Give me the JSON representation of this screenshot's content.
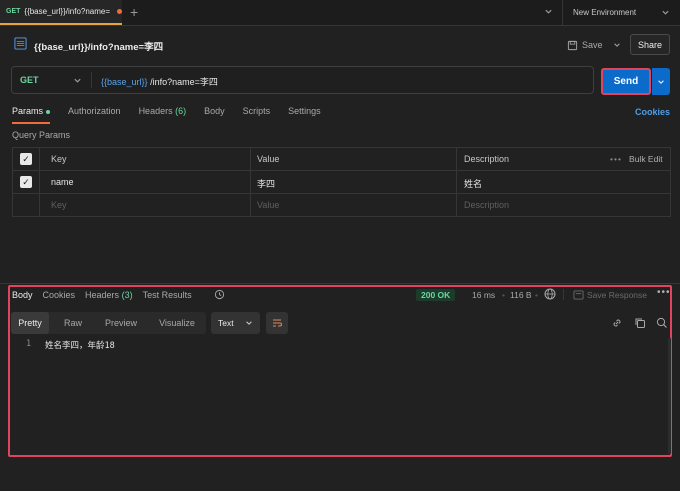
{
  "tab": {
    "method": "GET",
    "title": "{{base_url}}/info?name="
  },
  "environment": {
    "label": "New Environment"
  },
  "request": {
    "title": "{{base_url}}/info?name=李四",
    "save_label": "Save",
    "share_label": "Share",
    "method": "GET",
    "url_var": "{{base_url}}",
    "url_rest": "/info?name=李四",
    "send_label": "Send"
  },
  "request_tabs": [
    {
      "label": "Params"
    },
    {
      "label": "Authorization"
    },
    {
      "label": "Headers",
      "count": "(6)"
    },
    {
      "label": "Body"
    },
    {
      "label": "Scripts"
    },
    {
      "label": "Settings"
    }
  ],
  "cookies_link": "Cookies",
  "query_params": {
    "label": "Query Params",
    "headers": {
      "key": "Key",
      "value": "Value",
      "description": "Description",
      "bulk": "Bulk Edit"
    },
    "rows": [
      {
        "key": "name",
        "value": "李四",
        "description": "姓名"
      }
    ],
    "placeholders": {
      "key": "Key",
      "value": "Value",
      "description": "Description"
    }
  },
  "response": {
    "tabs": [
      {
        "label": "Body"
      },
      {
        "label": "Cookies"
      },
      {
        "label": "Headers",
        "count": "(3)"
      },
      {
        "label": "Test Results"
      }
    ],
    "status": "200 OK",
    "time": "16 ms",
    "size": "116 B",
    "save_response": "Save Response",
    "views": [
      "Pretty",
      "Raw",
      "Preview",
      "Visualize"
    ],
    "format": "Text",
    "line_number": "1",
    "body": "姓名李四，年龄18"
  },
  "colors": {
    "accent": "#f26b3a",
    "send": "#0b6bcb",
    "success": "#6bd5a0",
    "highlight": "#e0455d"
  }
}
